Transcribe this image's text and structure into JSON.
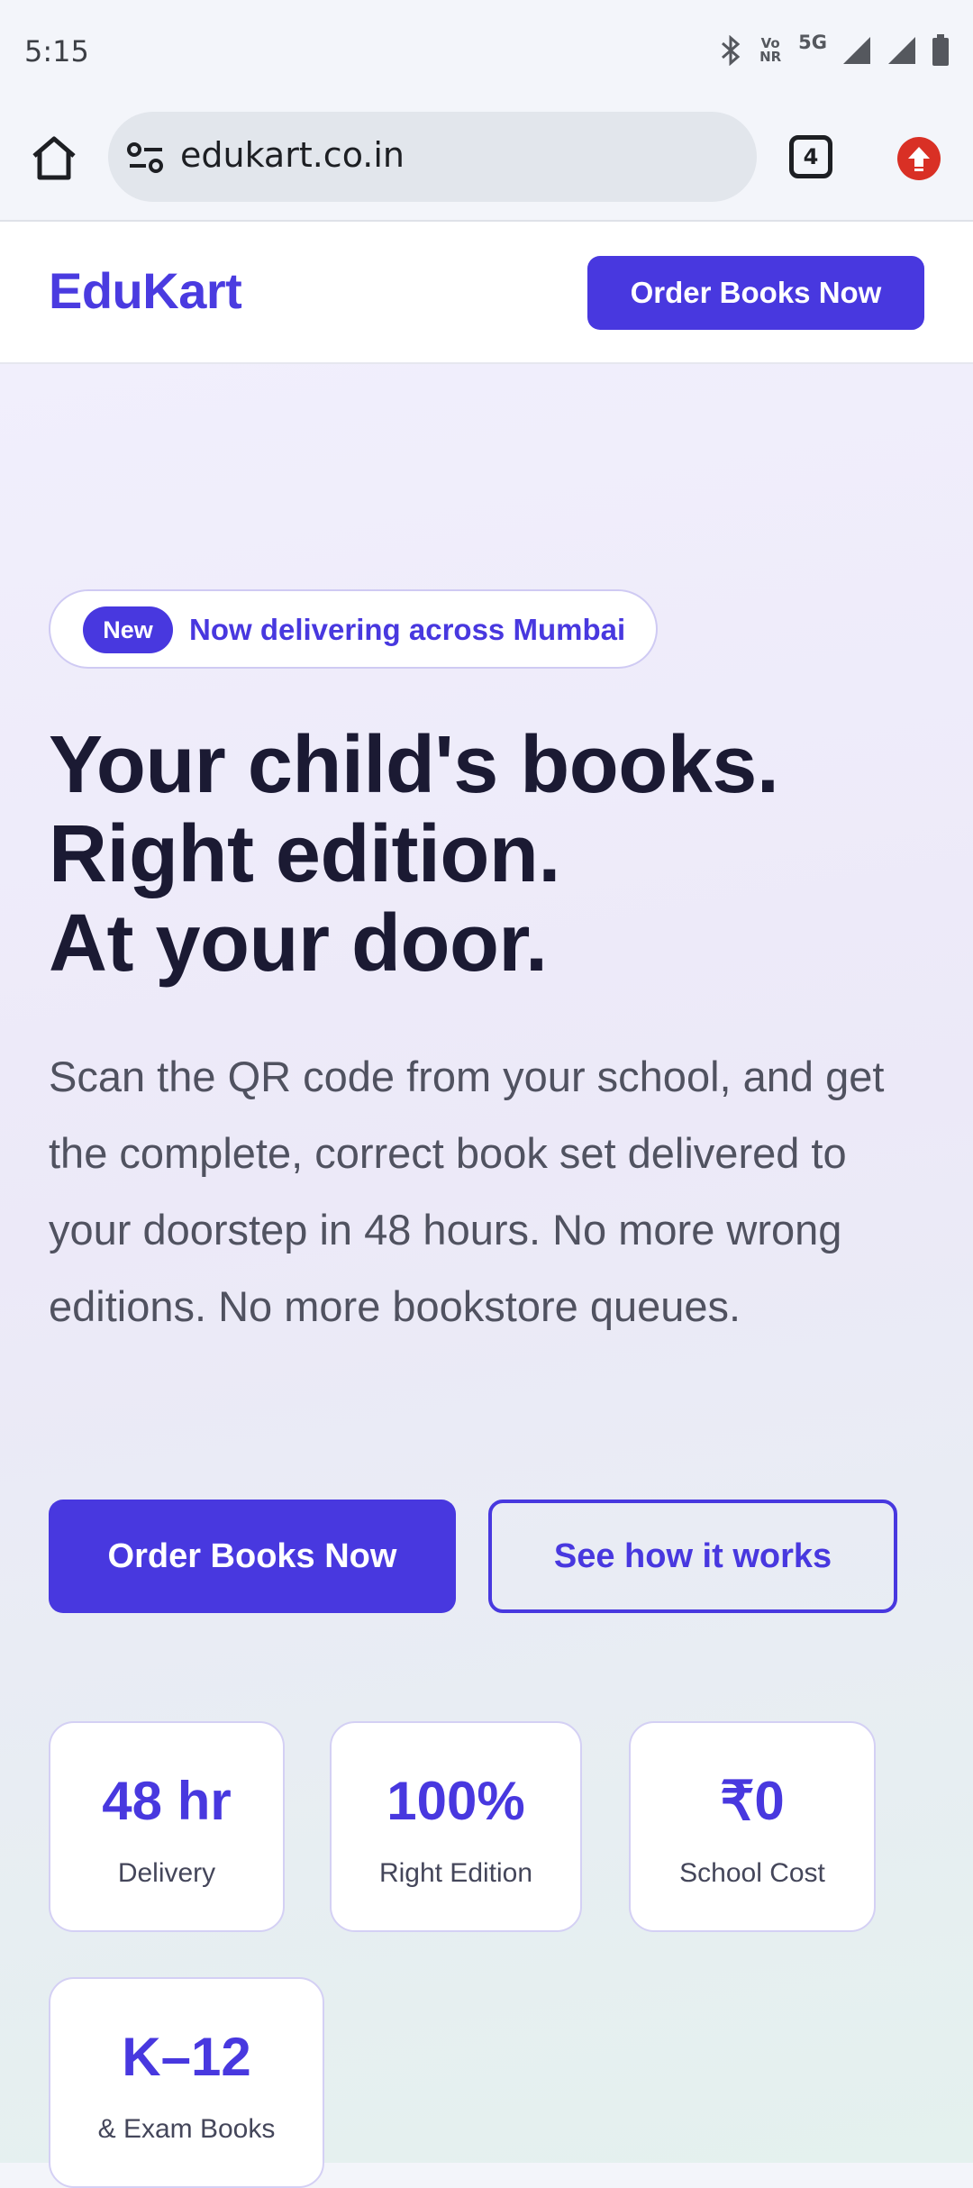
{
  "status_bar": {
    "time": "5:15",
    "network_label": "5G",
    "volte_label_top": "Vo",
    "volte_label_bottom": "NR"
  },
  "browser": {
    "url": "edukart.co.in",
    "tab_count": "4"
  },
  "header": {
    "logo": "EduKart",
    "cta_label": "Order Books Now"
  },
  "hero": {
    "badge_label": "New",
    "badge_text": "Now delivering across Mumbai",
    "headline": [
      "Your child's books.",
      "Right edition.",
      "At your door."
    ],
    "subcopy": "Scan the QR code from your school, and get the complete, correct book set delivered to your doorstep in 48 hours. No more wrong editions. No more bookstore queues.",
    "primary_button": "Order Books Now",
    "secondary_button": "See how it works"
  },
  "stats": [
    {
      "value": "48 hr",
      "label": "Delivery"
    },
    {
      "value": "100%",
      "label": "Right Edition"
    },
    {
      "value": "₹0",
      "label": "School Cost"
    },
    {
      "value": "K–12",
      "label": "& Exam Books"
    }
  ],
  "colors": {
    "brand": "#4838df",
    "headline": "#1b1a33",
    "body_text": "#505260",
    "update_badge": "#d93025"
  }
}
